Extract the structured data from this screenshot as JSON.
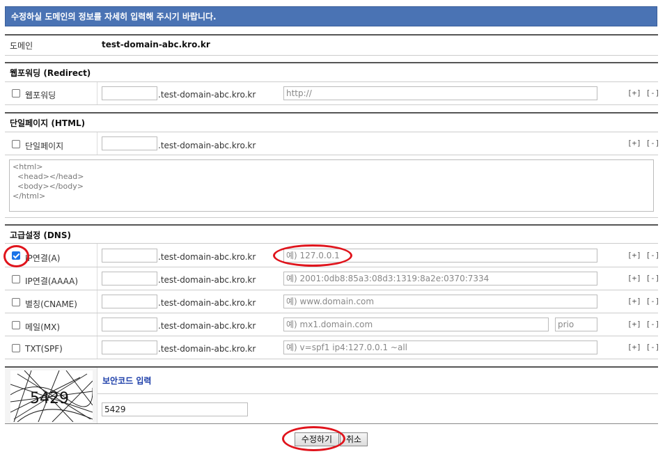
{
  "banner": {
    "text": "수정하실 도메인의 정보를 자세히 입력해 주시기 바랍니다."
  },
  "domain": {
    "label": "도메인",
    "value": "test-domain-abc.kro.kr"
  },
  "suffix": ".test-domain-abc.kro.kr",
  "plusminus": "[+] [-]",
  "webforward": {
    "section": "웹포워딩 (Redirect)",
    "label": "웹포워딩",
    "url_placeholder": "http://"
  },
  "singlepage": {
    "section": "단일페이지 (HTML)",
    "label": "단일페이지",
    "html": "<html>\n  <head></head>\n  <body></body>\n</html>"
  },
  "dns": {
    "section": "고급설정 (DNS)",
    "rows": [
      {
        "label": "IP연결(A)",
        "checked": true,
        "placeholder": "예) 127.0.0.1"
      },
      {
        "label": "IP연결(AAAA)",
        "checked": false,
        "placeholder": "예) 2001:0db8:85a3:08d3:1319:8a2e:0370:7334"
      },
      {
        "label": "별칭(CNAME)",
        "checked": false,
        "placeholder": "예) www.domain.com"
      },
      {
        "label": "메일(MX)",
        "checked": false,
        "placeholder": "예) mx1.domain.com",
        "prio_placeholder": "prio"
      },
      {
        "label": "TXT(SPF)",
        "checked": false,
        "placeholder": "예) v=spf1 ip4:127.0.0.1 ~all"
      }
    ]
  },
  "security": {
    "title": "보안코드 입력",
    "captcha_text": "5429",
    "input_value": "5429"
  },
  "buttons": {
    "submit": "수정하기",
    "cancel": "취소"
  },
  "colors": {
    "banner": "#4a73b4",
    "highlight": "#e0141c",
    "captcha_title": "#1a3ca8"
  }
}
